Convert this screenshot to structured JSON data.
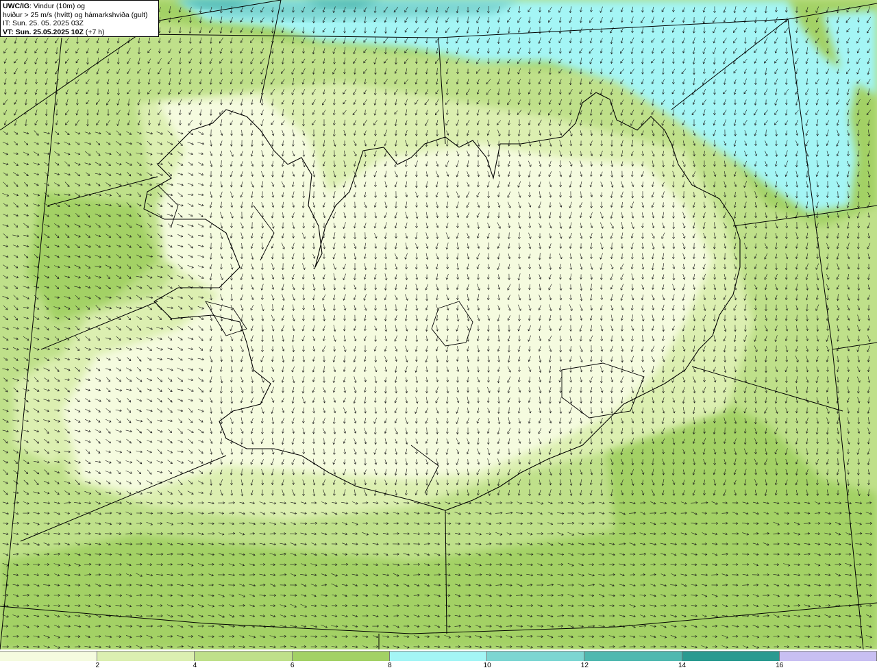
{
  "header": {
    "product": "UWC/IG",
    "title_rest": ": Vindur (10m) og",
    "line2": "hviður > 25 m/s (hvítt) og hámarkshviða (gult)",
    "issue_time": "IT: Sun. 25. 05. 2025 03Z",
    "valid_label": "VT: Sun. 25.05.2025 10Z",
    "valid_offset": " (+7 h)"
  },
  "legend": {
    "ticks": [
      "2",
      "4",
      "6",
      "8",
      "10",
      "12",
      "14",
      "16"
    ],
    "colors": [
      "#f5fbdf",
      "#dcefb1",
      "#bfe08a",
      "#a3d165",
      "#a4f5f5",
      "#7dd6d2",
      "#50b8b0",
      "#2a9a90",
      "#c8bff2"
    ]
  },
  "map": {
    "colors": {
      "land_light": "#f5fbdf",
      "green_2": "#dcefb1",
      "green_4": "#bfe08a",
      "green_6": "#a3d165",
      "cyan_8": "#a4f5f5",
      "teal_10": "#7dd6d2",
      "teal_12": "#50b8b0",
      "coastline": "#000000",
      "arrow": "#1a1a1a"
    }
  }
}
